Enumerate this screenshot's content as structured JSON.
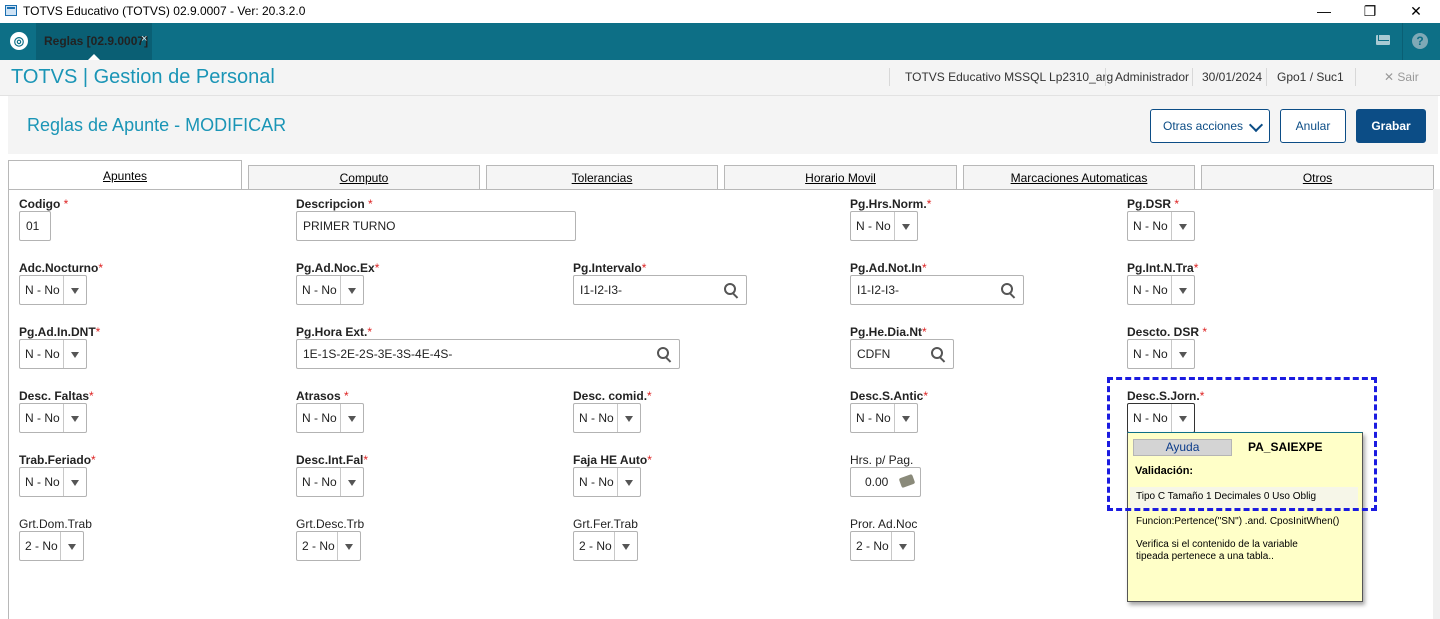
{
  "window": {
    "title": "TOTVS Educativo (TOTVS) 02.9.0007 - Ver: 20.3.2.0",
    "minimize": "—",
    "maximize": "❐",
    "close": "✕"
  },
  "appbar": {
    "tab_label": "Reglas [02.9.0007]",
    "tab_close": "×",
    "help": "?"
  },
  "header": {
    "brand": "TOTVS | Gestion de Personal",
    "environment": "TOTVS Educativo MSSQL Lp2310_arg",
    "user": "Administrador",
    "date": "30/01/2024",
    "branch": "Gpo1 / Suc1",
    "exit": "✕  Sair"
  },
  "page": {
    "title": "Reglas de Apunte - MODIFICAR",
    "buttons": {
      "otras": "Otras acciones",
      "anular": "Anular",
      "grabar": "Grabar"
    }
  },
  "tabs": [
    "Apuntes",
    "Computo",
    "Tolerancias",
    "Horario Movil",
    "Marcaciones Automaticas",
    "Otros"
  ],
  "fields": {
    "codigo": {
      "label": "Codigo",
      "req": "*",
      "value": "01"
    },
    "descripcion": {
      "label": "Descripcion",
      "req": "*",
      "value": "PRIMER TURNO"
    },
    "pg_hrs_norm": {
      "label": "Pg.Hrs.Norm.",
      "req": "*",
      "value": "N - No"
    },
    "pg_dsr": {
      "label": "Pg.DSR",
      "req": "*",
      "value": "N - No"
    },
    "adc_nocturno": {
      "label": "Adc.Nocturno",
      "req": "*",
      "value": "N - No"
    },
    "pg_ad_noc_ex": {
      "label": "Pg.Ad.Noc.Ex",
      "req": "*",
      "value": "N - No"
    },
    "pg_intervalo": {
      "label": "Pg.Intervalo",
      "req": "*",
      "value": "I1-I2-I3-"
    },
    "pg_ad_not_in": {
      "label": "Pg.Ad.Not.In",
      "req": "*",
      "value": "I1-I2-I3-"
    },
    "pg_int_n_tra": {
      "label": "Pg.Int.N.Tra",
      "req": "*",
      "value": "N - No"
    },
    "pg_ad_in_dnt": {
      "label": "Pg.Ad.In.DNT",
      "req": "*",
      "value": "N - No"
    },
    "pg_hora_ext": {
      "label": "Pg.Hora Ext.",
      "req": "*",
      "value": "1E-1S-2E-2S-3E-3S-4E-4S-"
    },
    "pg_he_dia_nt": {
      "label": "Pg.He.Dia.Nt",
      "req": "*",
      "value": "CDFN"
    },
    "descto_dsr": {
      "label": "Descto. DSR",
      "req": "*",
      "value": "N - No"
    },
    "desc_faltas": {
      "label": "Desc. Faltas",
      "req": "*",
      "value": "N - No"
    },
    "atrasos": {
      "label": "Atrasos",
      "req": "*",
      "value": "N - No"
    },
    "desc_comid": {
      "label": "Desc. comid.",
      "req": "*",
      "value": "N - No"
    },
    "desc_s_antic": {
      "label": "Desc.S.Antic",
      "req": "*",
      "value": "N - No"
    },
    "desc_s_jorn": {
      "label": "Desc.S.Jorn.",
      "req": "*",
      "value": "N - No"
    },
    "trab_feriado": {
      "label": "Trab.Feriado",
      "req": "*",
      "value": "N - No"
    },
    "desc_int_fal": {
      "label": "Desc.Int.Fal",
      "req": "*",
      "value": "N - No"
    },
    "faja_he_auto": {
      "label": "Faja HE Auto",
      "req": "*",
      "value": "N - No"
    },
    "hrs_p_pag": {
      "label": "Hrs. p/ Pag.",
      "value": "0.00"
    },
    "grt_dom_trab": {
      "label": "Grt.Dom.Trab",
      "value": "2 - No"
    },
    "grt_desc_trb": {
      "label": "Grt.Desc.Trb",
      "value": "2 - No"
    },
    "grt_fer_trab": {
      "label": "Grt.Fer.Trab",
      "value": "2 - No"
    },
    "pror_ad_noc": {
      "label": "Pror. Ad.Noc",
      "value": "2 - No"
    }
  },
  "help": {
    "button": "Ayuda",
    "code": "PA_SAIEXPE",
    "validation_title": "Validación:",
    "type_line": "Tipo C Tamaño   1 Decimales 0  Uso Oblig",
    "function": "Funcion:Pertence(\"SN\") .and. CposInitWhen()",
    "description": "Verifica si el contenido de la variable tipeada pertenece a una tabla.."
  },
  "colors": {
    "teal": "#0d6f86",
    "brand": "#1a95b6",
    "primary_button": "#0c4d86",
    "highlight": "#1b1be0",
    "tooltip": "#ffffc8"
  }
}
